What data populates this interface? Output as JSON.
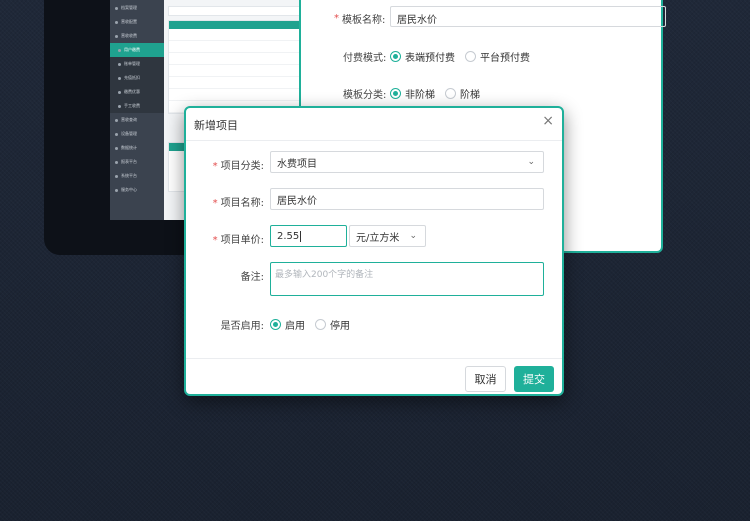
{
  "colors": {
    "accent": "#1fb09a",
    "required": "#e34d4d"
  },
  "mini_app": {
    "menu": [
      "档案管理",
      "营收配置",
      "营收收费",
      "用户缴费",
      "账单管理",
      "充值抵扣",
      "缴费优惠",
      "手工收费",
      "营收查询",
      "设备管理",
      "数据统计",
      "报表平台",
      "系统平台",
      "服务中心"
    ]
  },
  "template_panel": {
    "name_label": "模板名称:",
    "name_value": "居民水价",
    "pay_mode_label": "付费模式:",
    "pay_mode_options": [
      "表端预付费",
      "平台预付费"
    ],
    "category_label": "模板分类:",
    "category_options": [
      "非阶梯",
      "阶梯"
    ]
  },
  "dialog": {
    "title": "新增项目",
    "close_icon": "close-icon",
    "category_label": "项目分类:",
    "category_value": "水费项目",
    "name_label": "项目名称:",
    "name_value": "居民水价",
    "price_label": "项目单价:",
    "price_value": "2.55",
    "unit_value": "元/立方米",
    "remark_label": "备注:",
    "remark_placeholder": "最多输入200个字的备注",
    "enabled_label": "是否启用:",
    "enabled_options": [
      "启用",
      "停用"
    ],
    "cancel_label": "取消",
    "submit_label": "提交"
  }
}
